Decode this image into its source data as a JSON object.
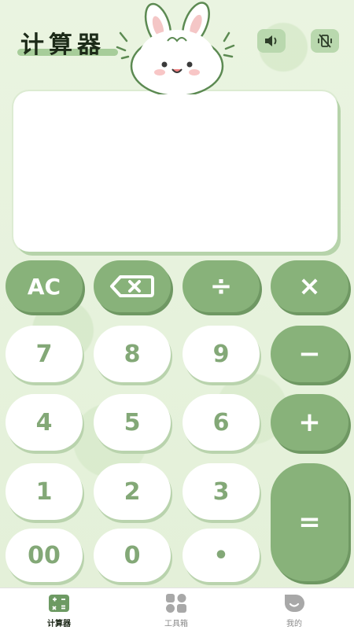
{
  "header": {
    "title": "计算器",
    "sound_button": "speaker-icon",
    "vibrate_button": "vibrate-off-icon"
  },
  "display": {
    "expression": "",
    "result": ""
  },
  "keypad": {
    "ac": "AC",
    "backspace": "backspace-icon",
    "divide": "÷",
    "multiply": "×",
    "minus": "−",
    "plus": "+",
    "equals": "=",
    "digits": {
      "d7": "7",
      "d8": "8",
      "d9": "9",
      "d4": "4",
      "d5": "5",
      "d6": "6",
      "d1": "1",
      "d2": "2",
      "d3": "3",
      "d00": "00",
      "d0": "0",
      "dot": "•"
    }
  },
  "tabbar": {
    "tabs": [
      {
        "label": "计算器",
        "icon": "calculator-icon",
        "active": true
      },
      {
        "label": "工具箱",
        "icon": "toolbox-grid-icon",
        "active": false
      },
      {
        "label": "我的",
        "icon": "profile-icon",
        "active": false
      }
    ]
  },
  "colors": {
    "background": "#e6f2dc",
    "key_green": "#88b27a",
    "key_white": "#ffffff",
    "key_text": "#83a877",
    "title_text": "#1c2a18"
  }
}
